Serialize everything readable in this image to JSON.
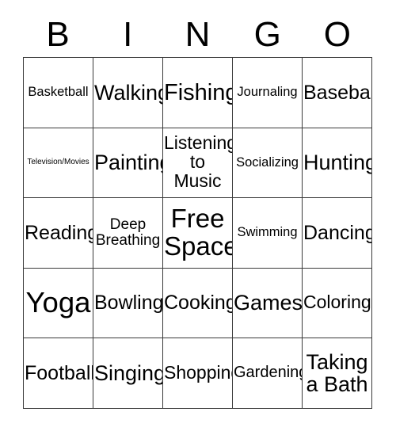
{
  "card": {
    "header_letters": [
      "B",
      "I",
      "N",
      "G",
      "O"
    ],
    "columns": 5,
    "rows": 5,
    "free_space_label": "Free\nSpace",
    "free_space_position": {
      "row": 3,
      "column": 3
    },
    "border_color": "#3a3a3a",
    "background_color": "#ffffff",
    "text_color": "#000000",
    "cells": [
      [
        {
          "text": "Basketball",
          "size": "fs-17"
        },
        {
          "text": "Walking",
          "size": "fs-27"
        },
        {
          "text": "Fishing",
          "size": "fs-29"
        },
        {
          "text": "Journaling",
          "size": "fs-17"
        },
        {
          "text": "Baseball",
          "size": "fs-25"
        }
      ],
      [
        {
          "text": "Television/Movies",
          "size": "fs-10"
        },
        {
          "text": "Painting",
          "size": "fs-27"
        },
        {
          "text": "Listening\nto Music",
          "size": "fs-23"
        },
        {
          "text": "Socializing",
          "size": "fs-17"
        },
        {
          "text": "Hunting",
          "size": "fs-27"
        }
      ],
      [
        {
          "text": "Reading",
          "size": "fs-25"
        },
        {
          "text": "Deep\nBreathing",
          "size": "fs-19"
        },
        {
          "text": "Free\nSpace",
          "size": "fs-33"
        },
        {
          "text": "Swimming",
          "size": "fs-17"
        },
        {
          "text": "Dancing",
          "size": "fs-25"
        }
      ],
      [
        {
          "text": "Yoga",
          "size": "fs-36"
        },
        {
          "text": "Bowling",
          "size": "fs-25"
        },
        {
          "text": "Cooking",
          "size": "fs-25"
        },
        {
          "text": "Games",
          "size": "fs-27"
        },
        {
          "text": "Coloring",
          "size": "fs-23"
        }
      ],
      [
        {
          "text": "Football",
          "size": "fs-25"
        },
        {
          "text": "Singing",
          "size": "fs-27"
        },
        {
          "text": "Shopping",
          "size": "fs-23"
        },
        {
          "text": "Gardening",
          "size": "fs-20"
        },
        {
          "text": "Taking\na Bath",
          "size": "fs-27"
        }
      ]
    ]
  }
}
